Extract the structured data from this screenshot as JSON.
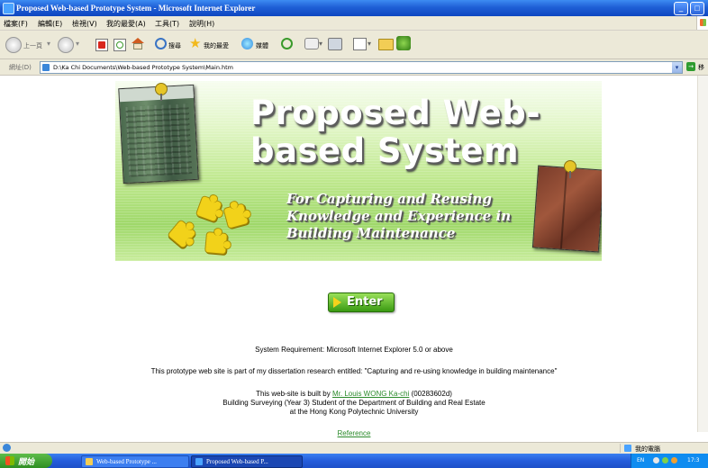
{
  "window": {
    "title": "Proposed Web-based Prototype System - Microsoft Internet Explorer",
    "minimize_glyph": "_",
    "maximize_glyph": "□",
    "close_glyph": "×"
  },
  "menu": {
    "items": [
      "檔案(F)",
      "編輯(E)",
      "檢視(V)",
      "我的最愛(A)",
      "工具(T)",
      "說明(H)"
    ]
  },
  "toolbar": {
    "back_label": "上一頁",
    "search_label": "搜尋",
    "favorites_label": "我的最愛",
    "media_label": "媒體"
  },
  "address": {
    "label": "網址(D)",
    "url": "D:\\Ka Chi Documents\\Web-based Prototype System\\Main.htm",
    "go_label": "移"
  },
  "banner": {
    "title_line1": "Proposed Web-",
    "title_line2": "based System",
    "subtitle_line1": "For Capturing and Reusing",
    "subtitle_line2": "Knowledge and Experience in",
    "subtitle_line3": "Building Maintenance"
  },
  "enter_button": {
    "label": "Enter"
  },
  "content": {
    "requirement": "System Requirement: Microsoft Internet Explorer 5.0 or above",
    "dissertation": "This prototype web site is part of my dissertation research entitled: \"Capturing and re-using knowledge in building maintenance\"",
    "built_by_prefix": "This web-site is built by ",
    "author_link": "Mr. Louis WONG Ka-chi",
    "author_id": " (00283602d)",
    "programme": "Building Surveying (Year 3) Student of the Department of Building and Real Estate",
    "university": "at the Hong Kong Polytechnic University",
    "reference_link": "Reference"
  },
  "statusbar": {
    "zone": "我的電腦"
  },
  "taskbar": {
    "start_label": "開始",
    "tasks": [
      {
        "label": "Web-based Prototype ..."
      },
      {
        "label": "Proposed Web-based P..."
      }
    ],
    "lang": "EN",
    "time": "17:3"
  },
  "colors": {
    "link": "#2a8a2a",
    "banner_green": "#9fd86a",
    "titlebar_blue": "#1f5fd6"
  }
}
